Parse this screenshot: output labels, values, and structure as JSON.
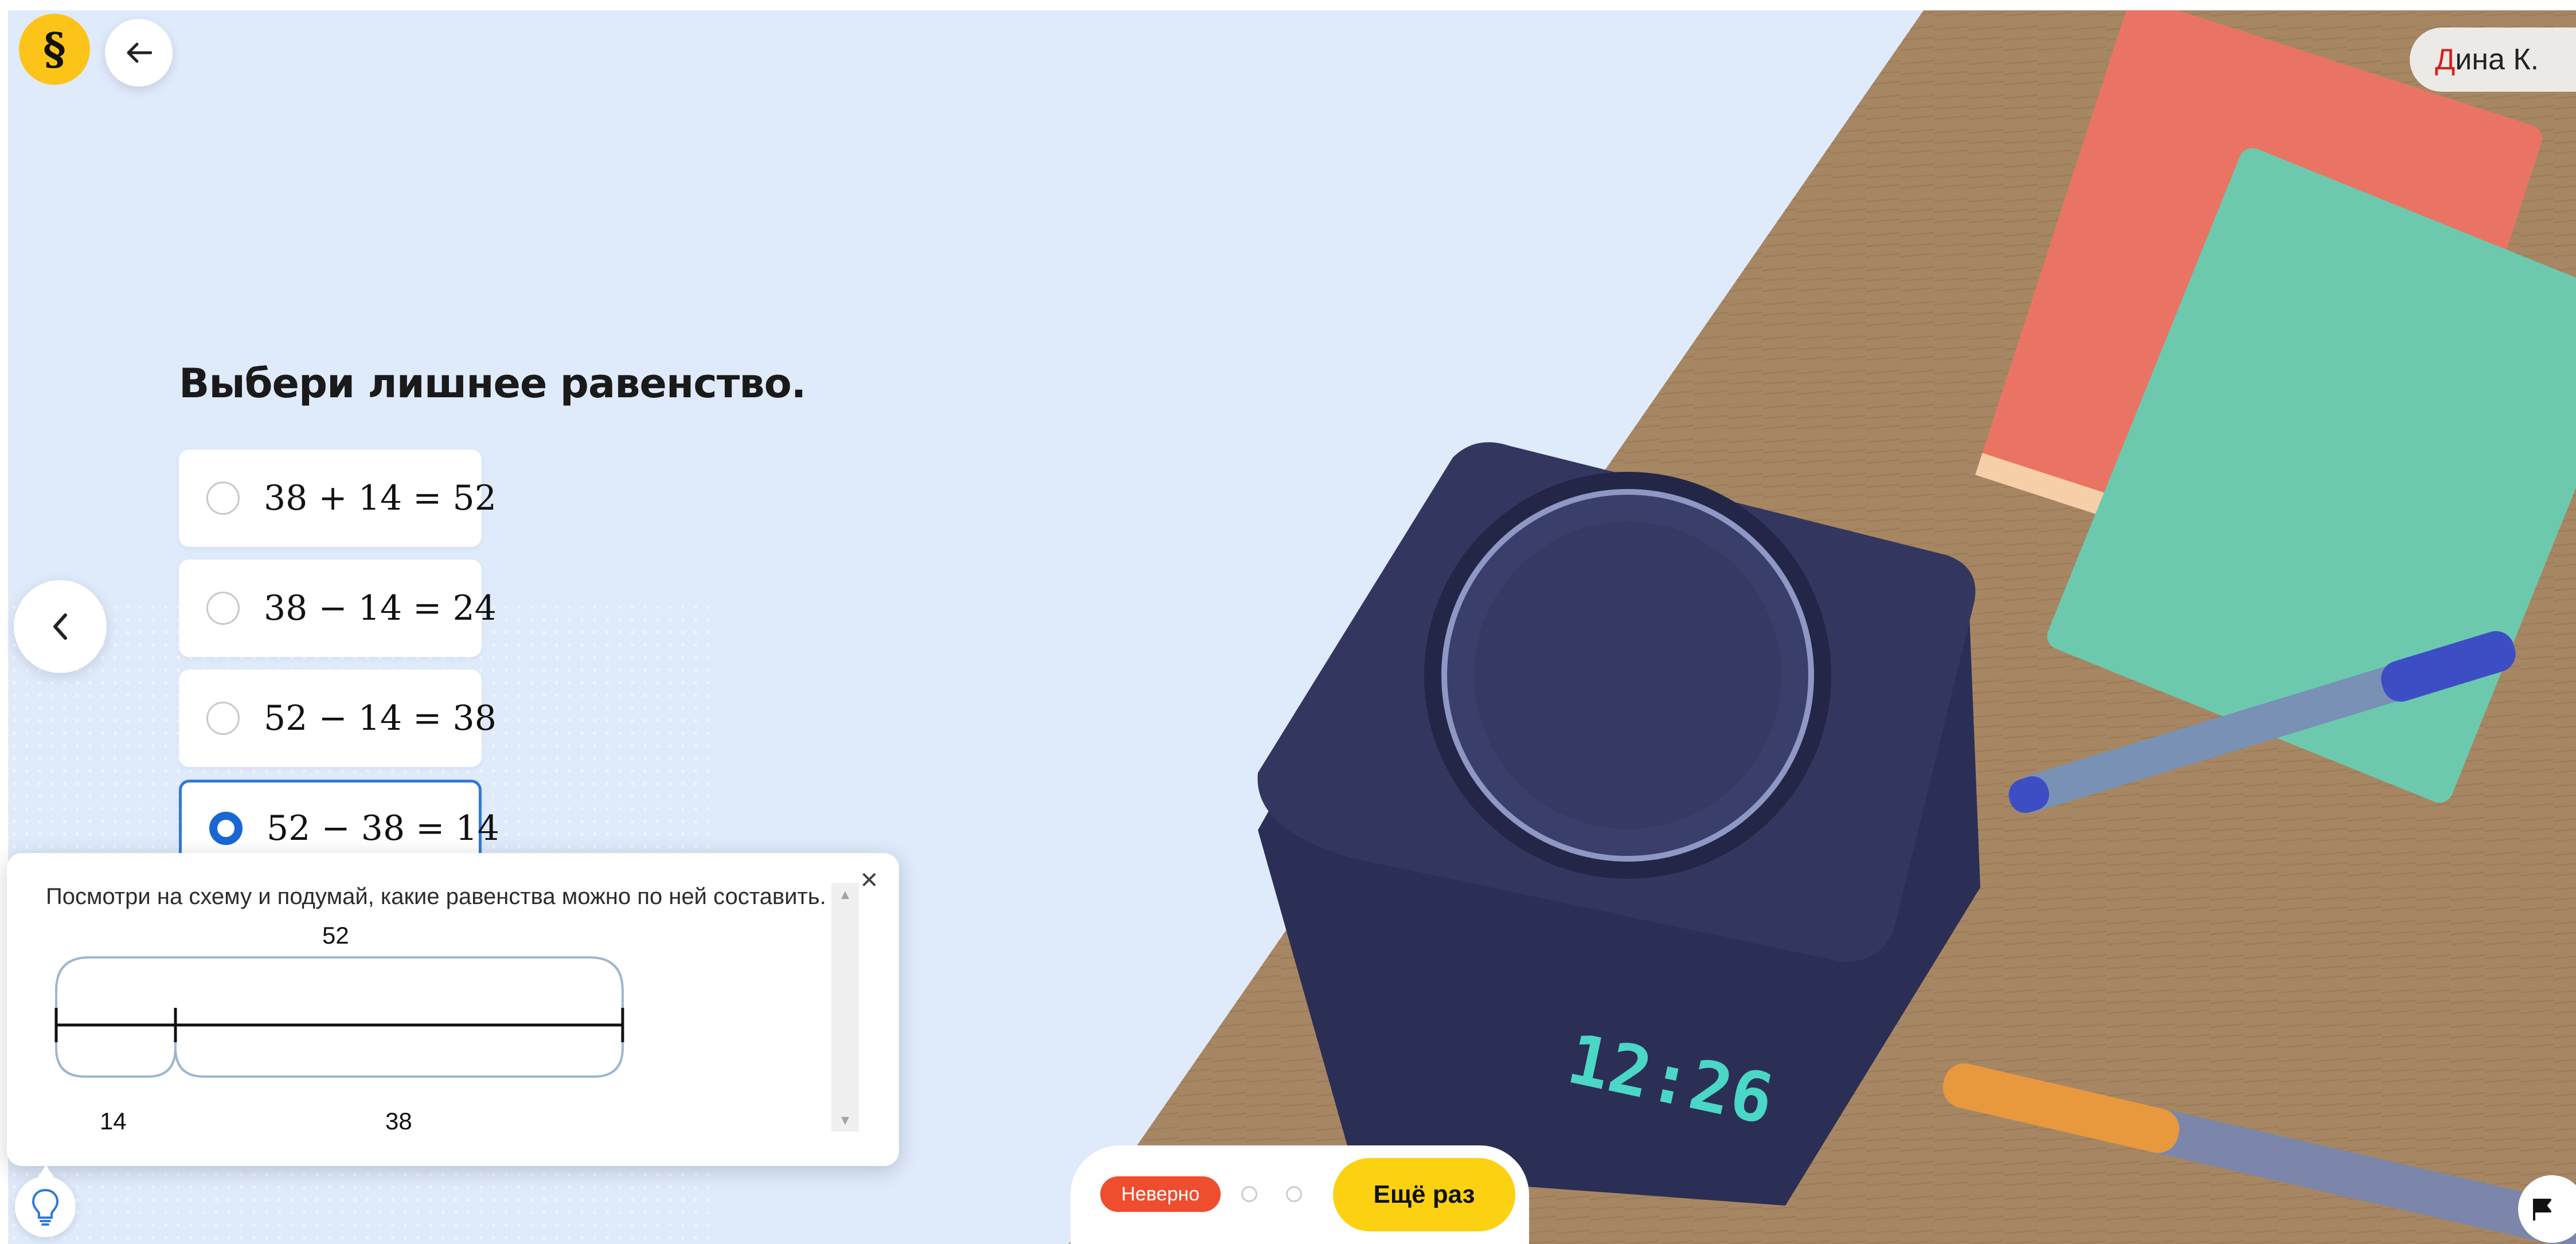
{
  "header": {
    "logo_icon": "paragraph-sign-icon",
    "back_icon": "arrow-left-icon",
    "user": {
      "initial": "Д",
      "rest": "ина К.",
      "initial_color": "#d81e1e"
    }
  },
  "task": {
    "question": "Выбери лишнее равенство.",
    "options": [
      {
        "label": "38 + 14 = 52",
        "selected": false
      },
      {
        "label": "38 − 14 = 24",
        "selected": false
      },
      {
        "label": "52 − 14 = 38",
        "selected": false
      },
      {
        "label": "52 − 38 = 14",
        "selected": true
      }
    ]
  },
  "hint": {
    "text": "Посмотри на схему и подумай, какие равенства можно по ней составить.",
    "close_icon": "close-icon",
    "scheme": {
      "total": "52",
      "part_a": "14",
      "part_b": "38"
    }
  },
  "footer": {
    "status": "Неверно",
    "status_color": "#ef4d2f",
    "retry_label": "Ещё раз",
    "retry_color": "#fcd112"
  },
  "icons": {
    "prev": "chevron-left-icon",
    "hint": "lightbulb-icon",
    "report": "flag-icon"
  },
  "illustration": {
    "clock_display": "12:26"
  }
}
